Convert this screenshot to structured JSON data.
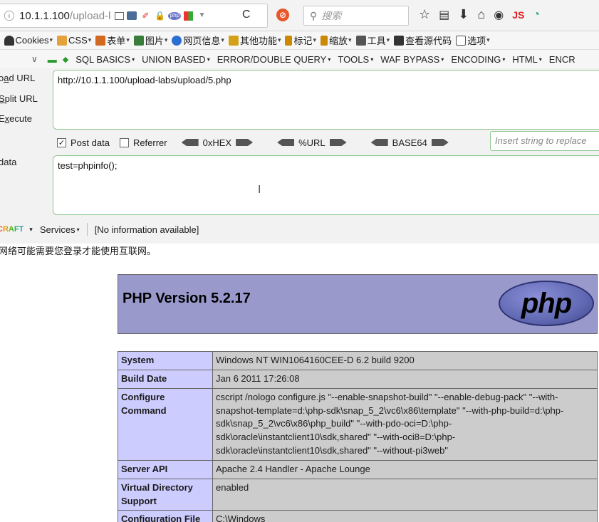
{
  "address_bar": {
    "url_host": "10.1.1.100",
    "url_path": "/upload-l",
    "search_placeholder": "搜索",
    "js_label": "JS"
  },
  "bookmarks": [
    {
      "label": "",
      "color": "#777777"
    },
    {
      "label": "Cookies",
      "color": "#444444"
    },
    {
      "label": "CSS",
      "color": "#d28b2a"
    },
    {
      "label": "表单",
      "color": "#d2691e"
    },
    {
      "label": "图片",
      "color": "#3a7d3a"
    },
    {
      "label": "网页信息",
      "color": "#2a6fd2"
    },
    {
      "label": "其他功能",
      "color": "#d4a017"
    },
    {
      "label": "标记",
      "color": "#cc8800"
    },
    {
      "label": "缩放",
      "color": "#cc8800"
    },
    {
      "label": "工具",
      "color": "#555555"
    },
    {
      "label": "查看源代码",
      "color": "#333333"
    },
    {
      "label": "选项",
      "color": "#555555"
    }
  ],
  "hackbar_menu": [
    "SQL BASICS",
    "UNION BASED",
    "ERROR/DOUBLE QUERY",
    "TOOLS",
    "WAF BYPASS",
    "ENCODING",
    "HTML",
    "ENCR"
  ],
  "hackbar": {
    "load_url_label_pre": "o",
    "load_url_label_u": "a",
    "load_url_label_post": "d URL",
    "split_url_label_pre": "",
    "split_url_label_u": "S",
    "split_url_label_post": "plit URL",
    "execute_label_pre": "E",
    "execute_label_u": "x",
    "execute_label_post": "ecute",
    "url_value": "http://10.1.1.100/upload-labs/upload/5.php",
    "post_data_checkbox": "Post data",
    "post_data_checked": "☑",
    "referrer_checkbox": "Referrer",
    "hex_label": "0xHEX",
    "url_enc_label": "%URL",
    "base64_label": "BASE64",
    "replace_placeholder": "Insert string to replace",
    "data_label": "data",
    "post_value": "test=phpinfo();"
  },
  "status_bar": {
    "craft_label": "CRAFT",
    "services_label": "Services",
    "info_text": "[No information available]"
  },
  "notice": "网络可能需要您登录才能使用互联网。",
  "phpinfo": {
    "version_title": "PHP Version 5.2.17",
    "logo_text": "php",
    "rows": [
      {
        "key": "System",
        "value": "Windows NT WIN1064160CEE-D 6.2 build 9200"
      },
      {
        "key": "Build Date",
        "value": "Jan 6 2011 17:26:08"
      },
      {
        "key": "Configure Command",
        "value": "cscript /nologo configure.js \"--enable-snapshot-build\" \"--enable-debug-pack\" \"--with-snapshot-template=d:\\php-sdk\\snap_5_2\\vc6\\x86\\template\" \"--with-php-build=d:\\php-sdk\\snap_5_2\\vc6\\x86\\php_build\" \"--with-pdo-oci=D:\\php-sdk\\oracle\\instantclient10\\sdk,shared\" \"--with-oci8=D:\\php-sdk\\oracle\\instantclient10\\sdk,shared\" \"--without-pi3web\""
      },
      {
        "key": "Server API",
        "value": "Apache 2.4 Handler - Apache Lounge"
      },
      {
        "key": "Virtual Directory Support",
        "value": "enabled"
      },
      {
        "key": "Configuration File",
        "value": "C:\\Windows"
      }
    ]
  }
}
